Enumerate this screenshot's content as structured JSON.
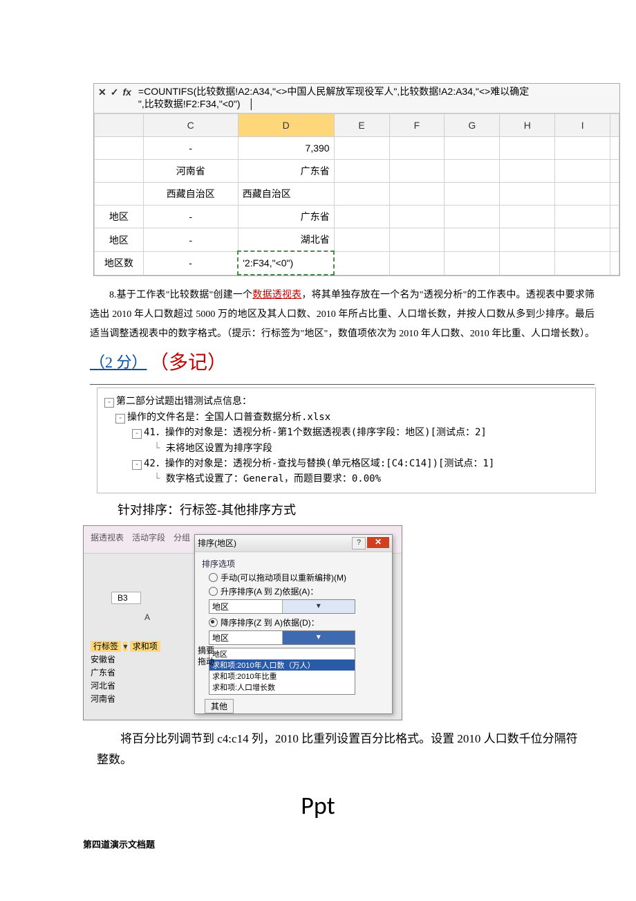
{
  "formula_bar": {
    "cancel_icon": "✕",
    "ok_icon": "✓",
    "fx_icon": "fx",
    "formula_line1": "=COUNTIFS(比较数据!A2:A34,\"<>中国人民解放军现役军人\",比较数据!A2:A34,\"<>难以确定",
    "formula_line2": "\",比较数据!F2:F34,\"<0\")"
  },
  "col_headers": [
    "C",
    "D",
    "E",
    "F",
    "G",
    "H",
    "I"
  ],
  "rows": [
    {
      "label": "",
      "c": "-",
      "d": "7,390",
      "d_align": "ralign"
    },
    {
      "label": "",
      "c": "河南省",
      "d": "广东省",
      "d_align": "ralign"
    },
    {
      "label": "",
      "c": "西藏自治区",
      "d": "西藏自治区",
      "d_align": ""
    },
    {
      "label": "地区",
      "c": "-",
      "d": "广东省",
      "d_align": "ralign"
    },
    {
      "label": "地区",
      "c": "-",
      "d": "湖北省",
      "d_align": "ralign"
    },
    {
      "label": "地区数",
      "c": "-",
      "d": "'2:F34,\"<0\")",
      "d_align": "",
      "dashed": true
    }
  ],
  "para8_prefix": "8.基于工作表\"比较数据\"创建一个",
  "para8_link": "数据透视表",
  "para8_rest": "，将其单独存放在一个名为\"透视分析\"的工作表中。透视表中要求筛选出 2010 年人口数超过 5000 万的地区及其人口数、2010 年所占比重、人口增长数，并按人口数从多到少排序。最后适当调整透视表中的数字格式。（提示：行标签为\"地区\"，数值项依次为 2010 年人口数、2010 年比重、人口增长数）。",
  "score": "（2 分）",
  "extra_note": "（多记）",
  "tree": {
    "root": "第二部分试题出错测试点信息：",
    "file": "操作的文件名是：全国人口普查数据分析.xlsx",
    "n41a": "41．操作的对象是：透视分析-第1个数据透视表(排序字段：地区)[测试点：2]",
    "n41b": "未将地区设置为排序字段",
    "n42a": "42．操作的对象是：透视分析-查找与替换(单元格区域:[C4:C14])[测试点：1]",
    "n42b": "数字格式设置了：General，而题目要求：0.00%"
  },
  "note_sort": "针对排序：行标签-其他排序方式",
  "ribbon": [
    "据透视表",
    "活动字段",
    "分组"
  ],
  "cell_name": "B3",
  "sheet_cols": "A",
  "pivot_labels": {
    "header": "行标签",
    "sumcol": "求和项",
    "items": [
      "安徽省",
      "广东省",
      "河北省",
      "河南省"
    ]
  },
  "dialog": {
    "title": "排序(地区)",
    "group": "排序选项",
    "opt_manual": "手动(可以拖动项目以重新编排)(M)",
    "opt_asc": "升序排序(A 到 Z)依据(A)：",
    "asc_value": "地区",
    "opt_desc": "降序排序(Z 到 A)依据(D)：",
    "desc_value": "地区",
    "summary_lbl": "摘要",
    "drag_lbl": "拖动",
    "list": [
      "地区",
      "求和项:2010年人口数（万人）",
      "求和项:2010年比重",
      "求和项:人口增长数"
    ],
    "more_btn": "其他"
  },
  "body2": "将百分比列调节到 c4:c14 列，2010 比重列设置百分比格式。设置 2010 人口数千位分隔符整数。",
  "ppt_heading": "Ppt",
  "section4": "第四道演示文档题"
}
